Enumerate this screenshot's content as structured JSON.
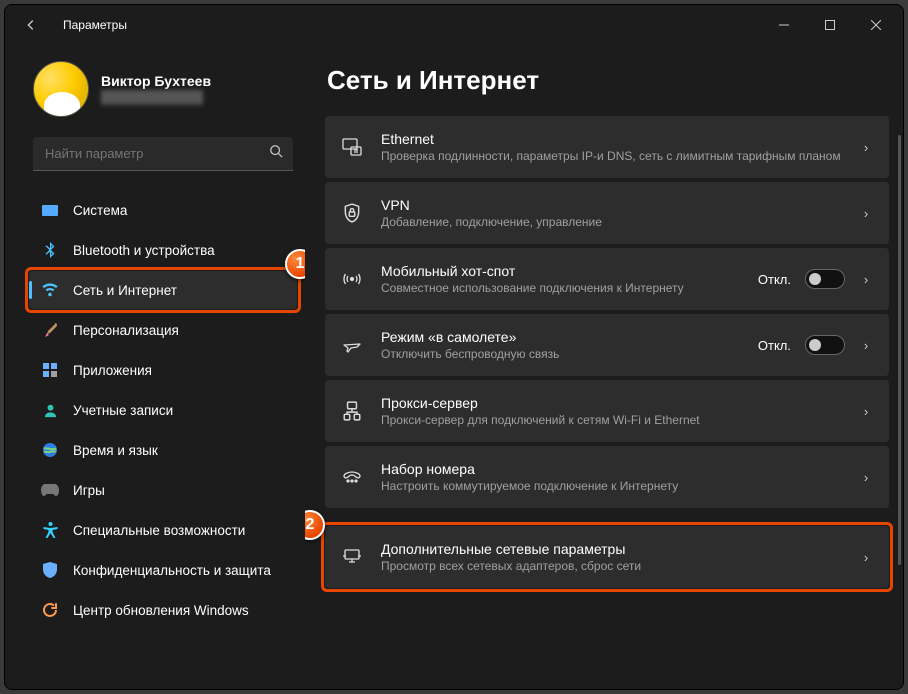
{
  "window": {
    "title": "Параметры"
  },
  "profile": {
    "name": "Виктор Бухтеев",
    "email": "████████████"
  },
  "search": {
    "placeholder": "Найти параметр"
  },
  "sidebar": {
    "items": [
      {
        "label": "Система"
      },
      {
        "label": "Bluetooth и устройства"
      },
      {
        "label": "Сеть и Интернет"
      },
      {
        "label": "Персонализация"
      },
      {
        "label": "Приложения"
      },
      {
        "label": "Учетные записи"
      },
      {
        "label": "Время и язык"
      },
      {
        "label": "Игры"
      },
      {
        "label": "Специальные возможности"
      },
      {
        "label": "Конфиденциальность и защита"
      },
      {
        "label": "Центр обновления Windows"
      }
    ]
  },
  "page": {
    "heading": "Сеть и Интернет"
  },
  "cards": [
    {
      "title": "Ethernet",
      "sub": "Проверка подлинности, параметры IP-и DNS, сеть с лимитным тарифным планом"
    },
    {
      "title": "VPN",
      "sub": "Добавление, подключение, управление"
    },
    {
      "title": "Мобильный хот-спот",
      "sub": "Совместное использование подключения к Интернету",
      "toggle": "Откл."
    },
    {
      "title": "Режим «в самолете»",
      "sub": "Отключить беспроводную связь",
      "toggle": "Откл."
    },
    {
      "title": "Прокси-сервер",
      "sub": "Прокси-сервер для подключений к сетям Wi-Fi и Ethernet"
    },
    {
      "title": "Набор номера",
      "sub": "Настроить коммутируемое подключение к Интернету"
    },
    {
      "title": "Дополнительные сетевые параметры",
      "sub": "Просмотр всех сетевых адаптеров, сброс сети"
    }
  ],
  "annotations": {
    "badge1": "1",
    "badge2": "2"
  }
}
